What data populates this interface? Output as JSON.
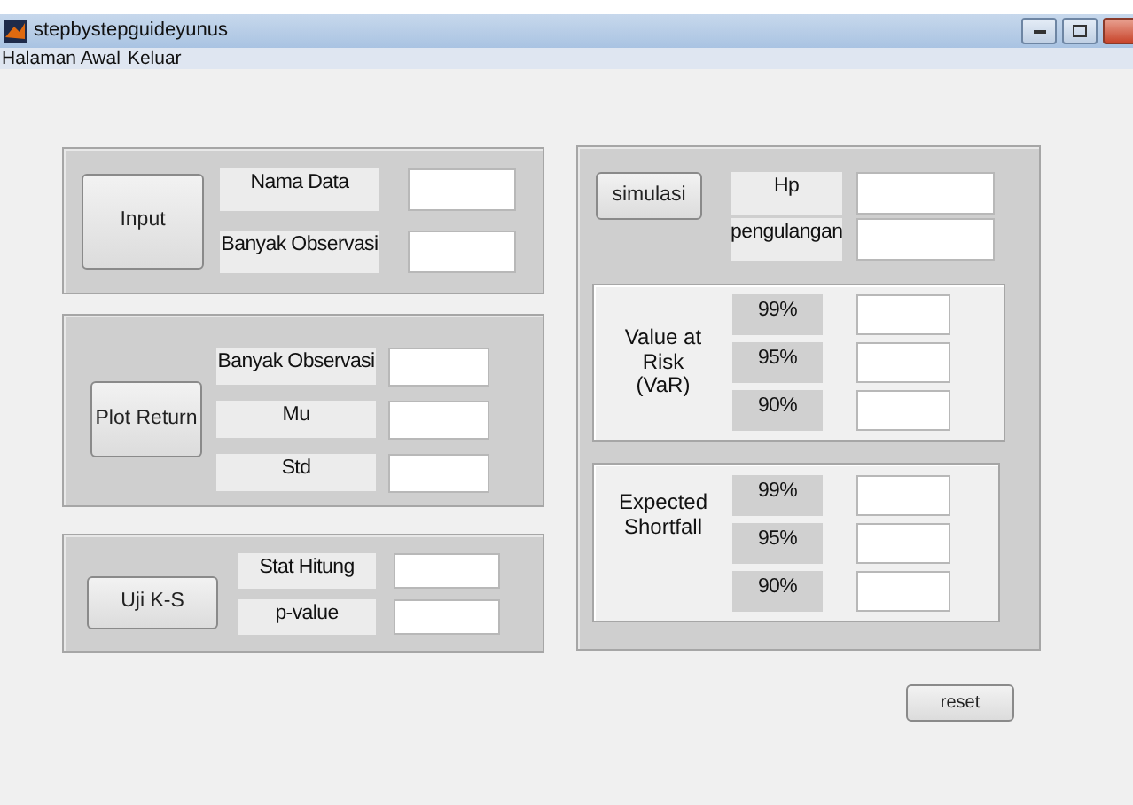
{
  "window": {
    "title": "stepbystepguideyunus"
  },
  "menu": [
    "Halaman Awal",
    "Keluar"
  ],
  "input_panel": {
    "button": "Input",
    "rows": [
      {
        "label": "Nama Data"
      },
      {
        "label": "Banyak Observasi"
      }
    ]
  },
  "plot_panel": {
    "button": "Plot Return",
    "rows": [
      {
        "label": "Banyak Observasi"
      },
      {
        "label": "Mu"
      },
      {
        "label": "Std"
      }
    ]
  },
  "ks_panel": {
    "button": "Uji K-S",
    "rows": [
      {
        "label": "Stat Hitung"
      },
      {
        "label": "p-value"
      }
    ]
  },
  "simulation_panel": {
    "button": "simulasi",
    "rows": [
      {
        "label": "Hp"
      },
      {
        "label": "pengulangan"
      }
    ],
    "groups": [
      {
        "title": "Value at\nRisk\n(VaR)",
        "rows": [
          {
            "label": "99%"
          },
          {
            "label": "95%"
          },
          {
            "label": "90%"
          }
        ]
      },
      {
        "title": "Expected\nShortfall",
        "rows": [
          {
            "label": "99%"
          },
          {
            "label": "95%"
          },
          {
            "label": "90%"
          }
        ]
      }
    ]
  },
  "reset_button": "reset"
}
